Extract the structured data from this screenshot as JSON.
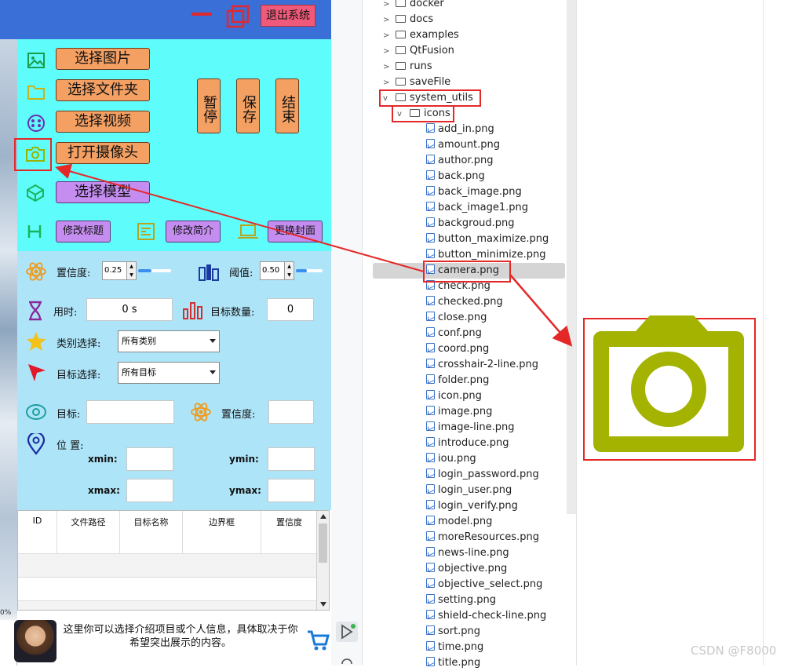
{
  "app": {
    "exit_label": "退出系统",
    "buttons": {
      "select_image": "选择图片",
      "select_folder": "选择文件夹",
      "select_video": "选择视频",
      "open_camera": "打开摄像头",
      "select_model": "选择模型",
      "pause": "暂停",
      "save": "保存",
      "end": "结束",
      "edit_title": "修改标题",
      "edit_intro": "修改简介",
      "change_cover": "更换封面"
    },
    "params": {
      "confidence_label": "置信度:",
      "confidence_value": "0.25",
      "threshold_label": "阈值:",
      "threshold_value": "0.50",
      "time_label": "用时:",
      "time_value": "0 s",
      "count_label": "目标数量:",
      "count_value": "0",
      "class_label": "类别选择:",
      "class_value": "所有类别",
      "target_label": "目标选择:",
      "target_value": "所有目标",
      "obj_label": "目标:",
      "obj_conf_label": "置信度:",
      "position_label": "位 置:",
      "xmin": "xmin:",
      "ymin": "ymin:",
      "xmax": "xmax:",
      "ymax": "ymax:"
    },
    "table": {
      "headers": [
        "ID",
        "文件路径",
        "目标名称",
        "边界框",
        "置信度"
      ]
    },
    "footer_text": "这里你可以选择介绍项目或个人信息，具体取决于你希望突出展示的内容。",
    "left_percent": "0%"
  },
  "ide": {
    "folders": [
      "docker",
      "docs",
      "examples",
      "QtFusion",
      "runs",
      "saveFile",
      "system_utils",
      "icons"
    ],
    "files": [
      "add_in.png",
      "amount.png",
      "author.png",
      "back.png",
      "back_image.png",
      "back_image1.png",
      "backgroud.png",
      "button_maximize.png",
      "button_minimize.png",
      "camera.png",
      "check.png",
      "checked.png",
      "close.png",
      "conf.png",
      "coord.png",
      "crosshair-2-line.png",
      "folder.png",
      "icon.png",
      "image.png",
      "image-line.png",
      "introduce.png",
      "iou.png",
      "login_password.png",
      "login_user.png",
      "login_verify.png",
      "model.png",
      "moreResources.png",
      "news-line.png",
      "objective.png",
      "objective_select.png",
      "setting.png",
      "shield-check-line.png",
      "sort.png",
      "time.png",
      "title.png"
    ],
    "selected": "camera.png"
  },
  "colors": {
    "accent_red": "#e42828",
    "camera_icon": "#a3b300",
    "cyan_panel": "#5ffcfc",
    "blue_panel": "#aee4f8",
    "orange_button": "#f4a063"
  },
  "watermark": "CSDN @F8000"
}
